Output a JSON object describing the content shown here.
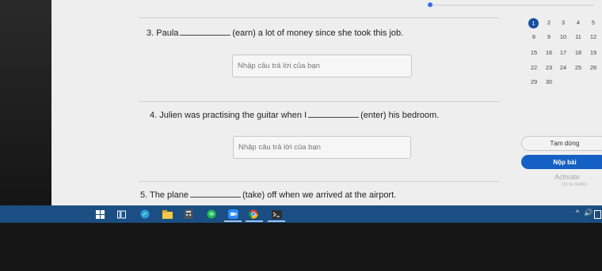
{
  "questions": [
    {
      "number": "3.",
      "before": "Paula",
      "after": "(earn) a lot of money since she took this job."
    },
    {
      "number": "4.",
      "before": "Julien was practising the guitar when I",
      "after": "(enter) his bedroom."
    },
    {
      "number": "5.",
      "before": "The plane",
      "after": "(take) off when we arrived at the airport."
    }
  ],
  "answer_placeholder": "Nhập câu trả lời của bạn",
  "question_nav": {
    "current": "1",
    "numbers": [
      "1",
      "2",
      "3",
      "4",
      "5",
      "8",
      "9",
      "10",
      "11",
      "12",
      "15",
      "16",
      "17",
      "18",
      "19",
      "22",
      "23",
      "24",
      "25",
      "26",
      "29",
      "30"
    ]
  },
  "buttons": {
    "pause": "Tạm dừng",
    "submit": "Nộp bài"
  },
  "watermark": {
    "title": "Activate",
    "subtitle": "Go to Settin"
  },
  "taskbar": {
    "icons": [
      "windows-start-icon",
      "task-view-icon",
      "edge-icon",
      "file-explorer-icon",
      "calculator-icon",
      "spotify-icon",
      "zoom-icon",
      "chrome-icon",
      "terminal-icon"
    ],
    "tray": {
      "caret": "^",
      "volume": "🔊"
    }
  },
  "colors": {
    "accent": "#1560c4",
    "current_number": "#1a4fa0",
    "taskbar": "#1b4f83"
  }
}
